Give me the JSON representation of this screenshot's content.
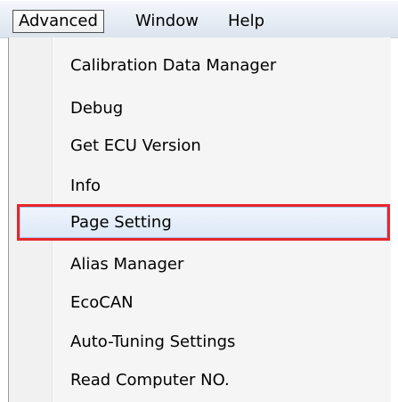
{
  "menubar": {
    "items": [
      {
        "label": "Advanced",
        "active": true
      },
      {
        "label": "Window",
        "active": false
      },
      {
        "label": "Help",
        "active": false
      }
    ]
  },
  "dropdown": {
    "items": [
      {
        "label": "Calibration Data Manager"
      },
      {
        "label": "Debug"
      },
      {
        "label": "Get ECU Version"
      },
      {
        "label": "Info"
      },
      {
        "label": "Page Setting",
        "highlighted": true
      },
      {
        "label": "Alias Manager"
      },
      {
        "label": "EcoCAN"
      },
      {
        "label": "Auto-Tuning Settings"
      },
      {
        "label": "Read Computer NO."
      }
    ]
  },
  "colors": {
    "highlight_border": "#e8262b",
    "hover_fill": "#dde9f8",
    "menu_background": "#f5f5f5"
  }
}
